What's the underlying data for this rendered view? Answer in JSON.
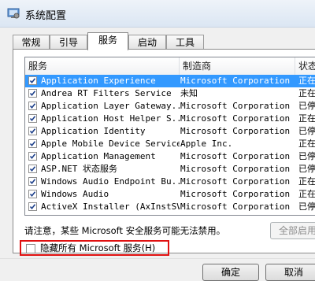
{
  "window": {
    "title": "系统配置"
  },
  "tabs": [
    {
      "label": "常规"
    },
    {
      "label": "引导"
    },
    {
      "label": "服务"
    },
    {
      "label": "启动"
    },
    {
      "label": "工具"
    }
  ],
  "active_tab": "服务",
  "columns": {
    "name": "服务",
    "maker": "制造商",
    "status": "状态"
  },
  "services": [
    {
      "name": "Application Experience",
      "maker": "Microsoft Corporation",
      "status": "正在",
      "checked": true,
      "selected": true
    },
    {
      "name": "Andrea RT Filters Service",
      "maker": "未知",
      "status": "正在",
      "checked": true
    },
    {
      "name": "Application Layer Gateway...",
      "maker": "Microsoft Corporation",
      "status": "已停",
      "checked": true
    },
    {
      "name": "Application Host Helper S...",
      "maker": "Microsoft Corporation",
      "status": "正在",
      "checked": true
    },
    {
      "name": "Application Identity",
      "maker": "Microsoft Corporation",
      "status": "已停",
      "checked": true
    },
    {
      "name": "Apple Mobile Device Service",
      "maker": "Apple Inc.",
      "status": "正在",
      "checked": true
    },
    {
      "name": "Application Management",
      "maker": "Microsoft Corporation",
      "status": "已停",
      "checked": true
    },
    {
      "name": "ASP.NET 状态服务",
      "maker": "Microsoft Corporation",
      "status": "已停",
      "checked": true
    },
    {
      "name": "Windows Audio Endpoint Bu...",
      "maker": "Microsoft Corporation",
      "status": "正在",
      "checked": true
    },
    {
      "name": "Windows Audio",
      "maker": "Microsoft Corporation",
      "status": "正在",
      "checked": true
    },
    {
      "name": "ActiveX Installer (AxInstSV)",
      "maker": "Microsoft Corporation",
      "status": "已停",
      "checked": true
    }
  ],
  "notice": "请注意，某些 Microsoft 安全服务可能无法禁用。",
  "enable_all_label": "全部启用",
  "hide_ms_label": "隐藏所有 Microsoft 服务(H)",
  "ok_label": "确定",
  "cancel_label": "取消",
  "colors": {
    "selection": "#3399ff",
    "highlight_box": "#e01010"
  }
}
